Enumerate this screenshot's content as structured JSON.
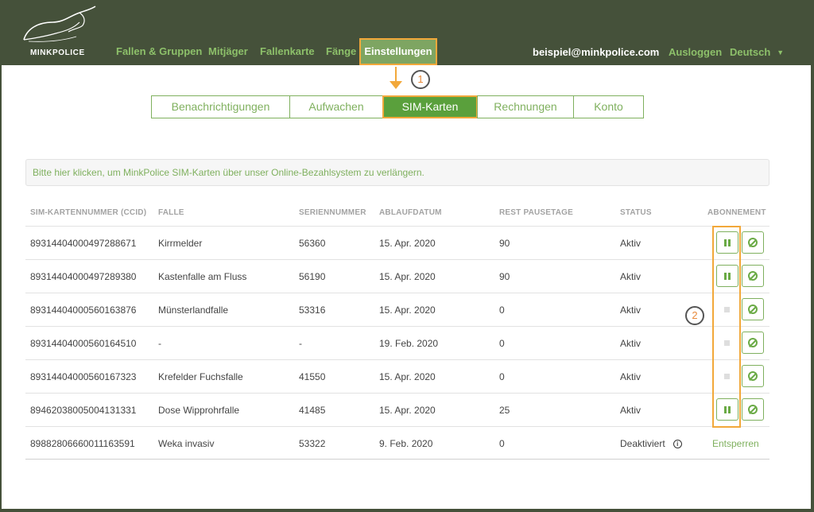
{
  "brand": {
    "name": "MINKPOLICE"
  },
  "nav": {
    "items": [
      {
        "label": "Fallen & Gruppen"
      },
      {
        "label": "Mitjäger"
      },
      {
        "label": "Fallenkarte"
      },
      {
        "label": "Fänge"
      },
      {
        "label": "Einstellungen",
        "active": true
      }
    ],
    "user_email": "beispiel@minkpolice.com",
    "logout": "Ausloggen",
    "language": "Deutsch"
  },
  "annotations": {
    "step1": "1",
    "step2": "2"
  },
  "subtabs": [
    {
      "label": "Benachrichtigungen"
    },
    {
      "label": "Aufwachen"
    },
    {
      "label": "SIM-Karten",
      "active": true
    },
    {
      "label": "Rechnungen"
    },
    {
      "label": "Konto"
    }
  ],
  "banner": {
    "text": "Bitte hier klicken, um MinkPolice SIM-Karten über unser Online-Bezahlsystem zu verlängern."
  },
  "table": {
    "headers": {
      "ccid": "SIM-KARTENNUMMER (CCID)",
      "trap": "FALLE",
      "serial": "SERIENNUMMER",
      "expiry": "ABLAUFDATUM",
      "pause_days": "REST PAUSETAGE",
      "status": "STATUS",
      "subscription": "ABONNEMENT"
    },
    "rows": [
      {
        "ccid": "89314404000497288671",
        "trap": "Kirrmelder",
        "serial": "56360",
        "expiry": "15. Apr. 2020",
        "pause_days": "90",
        "status": "Aktiv"
      },
      {
        "ccid": "89314404000497289380",
        "trap": "Kastenfalle am Fluss",
        "serial": "56190",
        "expiry": "15. Apr. 2020",
        "pause_days": "90",
        "status": "Aktiv"
      },
      {
        "ccid": "89314404000560163876",
        "trap": "Münsterlandfalle",
        "serial": "53316",
        "expiry": "15. Apr. 2020",
        "pause_days": "0",
        "status": "Aktiv"
      },
      {
        "ccid": "89314404000560164510",
        "trap": "-",
        "serial": "-",
        "expiry": "19. Feb. 2020",
        "pause_days": "0",
        "status": "Aktiv"
      },
      {
        "ccid": "89314404000560167323",
        "trap": "Krefelder Fuchsfalle",
        "serial": "41550",
        "expiry": "15. Apr. 2020",
        "pause_days": "0",
        "status": "Aktiv"
      },
      {
        "ccid": "89462038005004131331",
        "trap": "Dose Wipprohrfalle",
        "serial": "41485",
        "expiry": "15. Apr. 2020",
        "pause_days": "25",
        "status": "Aktiv"
      },
      {
        "ccid": "89882806660011163591",
        "trap": "Weka invasiv",
        "serial": "53322",
        "expiry": "9. Feb. 2020",
        "pause_days": "0",
        "status": "Deaktiviert",
        "info_icon": "i",
        "action": "Entsperren"
      }
    ]
  },
  "colors": {
    "header_bg": "#45513a",
    "accent_green": "#7fb05e",
    "active_green": "#5aa03c",
    "highlight_orange": "#f2a83a"
  }
}
